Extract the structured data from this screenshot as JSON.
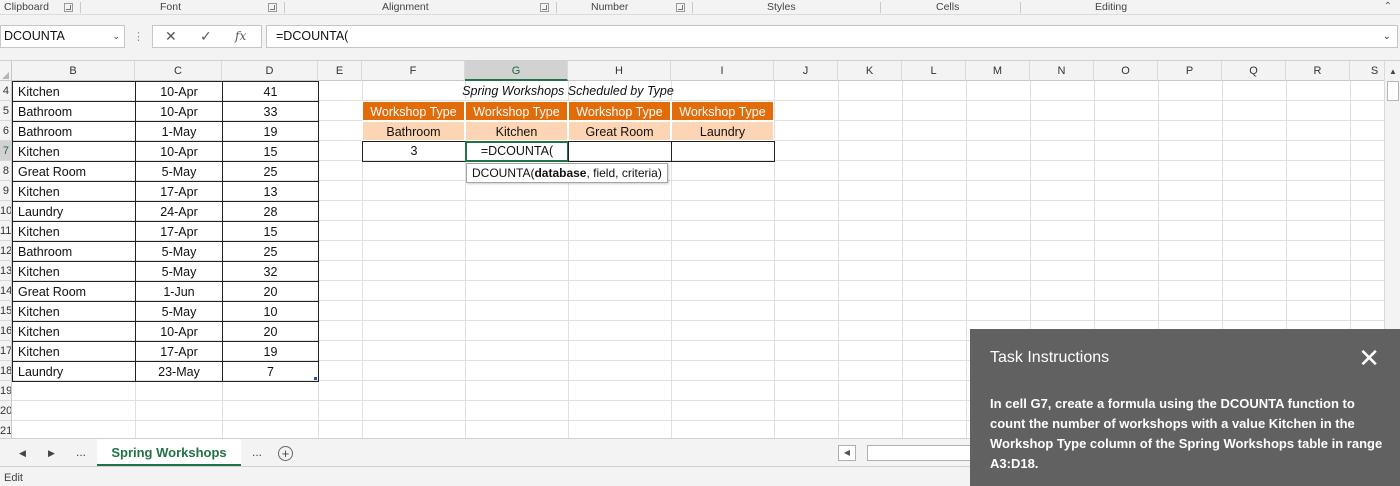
{
  "ribbon": {
    "groups": [
      "Clipboard",
      "Font",
      "Alignment",
      "Number",
      "Styles",
      "Cells",
      "Editing"
    ]
  },
  "formula_bar": {
    "name_box": "DCOUNTA",
    "formula": "=DCOUNTA(",
    "cancel_icon": "✕",
    "enter_icon": "✓",
    "fx_label": "fx"
  },
  "columns": [
    "B",
    "C",
    "D",
    "E",
    "F",
    "G",
    "H",
    "I",
    "J",
    "K",
    "L",
    "M",
    "N",
    "O",
    "P",
    "Q",
    "R",
    "S"
  ],
  "row_numbers": [
    "4",
    "5",
    "6",
    "7",
    "8",
    "9",
    "10",
    "11",
    "12",
    "13",
    "14",
    "15",
    "16",
    "17",
    "18",
    "19",
    "20",
    "21"
  ],
  "table": {
    "rows": [
      {
        "type": "Kitchen",
        "date": "10-Apr",
        "count": "41"
      },
      {
        "type": "Bathroom",
        "date": "10-Apr",
        "count": "33"
      },
      {
        "type": "Bathroom",
        "date": "1-May",
        "count": "19"
      },
      {
        "type": "Kitchen",
        "date": "10-Apr",
        "count": "15"
      },
      {
        "type": "Great Room",
        "date": "5-May",
        "count": "25"
      },
      {
        "type": "Kitchen",
        "date": "17-Apr",
        "count": "13"
      },
      {
        "type": "Laundry",
        "date": "24-Apr",
        "count": "28"
      },
      {
        "type": "Kitchen",
        "date": "17-Apr",
        "count": "15"
      },
      {
        "type": "Bathroom",
        "date": "5-May",
        "count": "25"
      },
      {
        "type": "Kitchen",
        "date": "5-May",
        "count": "32"
      },
      {
        "type": "Great Room",
        "date": "1-Jun",
        "count": "20"
      },
      {
        "type": "Kitchen",
        "date": "5-May",
        "count": "10"
      },
      {
        "type": "Kitchen",
        "date": "10-Apr",
        "count": "20"
      },
      {
        "type": "Kitchen",
        "date": "17-Apr",
        "count": "19"
      },
      {
        "type": "Laundry",
        "date": "23-May",
        "count": "7"
      }
    ]
  },
  "summary": {
    "title": "Spring Workshops Scheduled by Type",
    "headers": [
      "Workshop Type",
      "Workshop Type",
      "Workshop Type",
      "Workshop Type"
    ],
    "criteria": [
      "Bathroom",
      "Kitchen",
      "Great Room",
      "Laundry"
    ],
    "results": [
      "3",
      "=DCOUNTA(",
      "",
      ""
    ]
  },
  "tooltip": {
    "fn": "DCOUNTA(",
    "arg_bold": "database",
    "rest": ", field, criteria)"
  },
  "sheet_tabs": {
    "active": "Spring Workshops",
    "ellipsis_left": "...",
    "ellipsis_right": "..."
  },
  "status": "Edit",
  "task": {
    "title": "Task Instructions",
    "body": "In cell G7, create a formula using the DCOUNTA function to count the number of workshops with a value Kitchen in the Workshop Type column of the Spring Workshops table in range A3:D18."
  }
}
